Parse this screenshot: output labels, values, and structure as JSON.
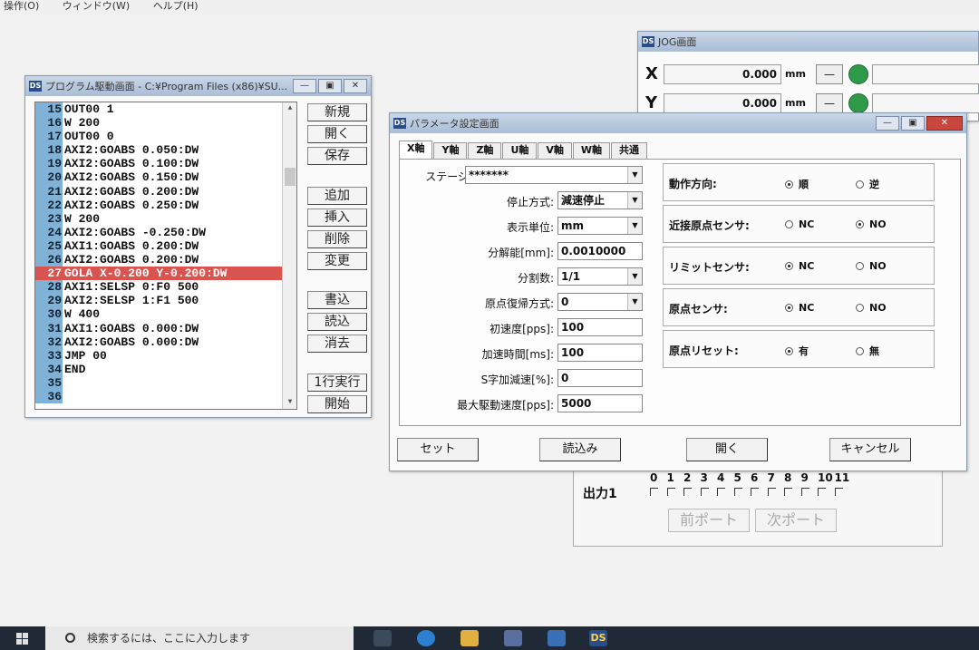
{
  "menubar": [
    "操作(O)",
    "ウィンドウ(W)",
    "ヘルプ(H)"
  ],
  "program_window": {
    "title": "プログラム駆動画面 - C:¥Program Files (x86)¥SU...",
    "lines": [
      {
        "num": "15",
        "code": "OUT00 1"
      },
      {
        "num": "16",
        "code": "W 200"
      },
      {
        "num": "17",
        "code": "OUT00 0"
      },
      {
        "num": "18",
        "code": "AXI2:GOABS 0.050:DW"
      },
      {
        "num": "19",
        "code": "AXI2:GOABS 0.100:DW"
      },
      {
        "num": "20",
        "code": "AXI2:GOABS 0.150:DW"
      },
      {
        "num": "21",
        "code": "AXI2:GOABS 0.200:DW"
      },
      {
        "num": "22",
        "code": "AXI2:GOABS 0.250:DW"
      },
      {
        "num": "23",
        "code": "W 200"
      },
      {
        "num": "24",
        "code": "AXI2:GOABS -0.250:DW"
      },
      {
        "num": "25",
        "code": "AXI1:GOABS 0.200:DW"
      },
      {
        "num": "26",
        "code": "AXI2:GOABS 0.200:DW"
      },
      {
        "num": "27",
        "code": "GOLA X-0.200 Y-0.200:DW"
      },
      {
        "num": "28",
        "code": "AXI1:SELSP 0:F0 500"
      },
      {
        "num": "29",
        "code": "AXI2:SELSP 1:F1 500"
      },
      {
        "num": "30",
        "code": "W 400"
      },
      {
        "num": "31",
        "code": "AXI1:GOABS 0.000:DW"
      },
      {
        "num": "32",
        "code": "AXI2:GOABS 0.000:DW"
      },
      {
        "num": "33",
        "code": "JMP 00"
      },
      {
        "num": "34",
        "code": "END"
      },
      {
        "num": "35",
        "code": ""
      },
      {
        "num": "36",
        "code": ""
      }
    ],
    "selected_line": "27",
    "buttons": {
      "new": "新規",
      "open": "開く",
      "save": "保存",
      "add": "追加",
      "insert": "挿入",
      "delete": "削除",
      "change": "変更",
      "write": "書込",
      "read": "読込",
      "erase": "消去",
      "step": "1行実行",
      "start": "開始"
    }
  },
  "jog_window": {
    "title": "JOG画面",
    "axes": [
      {
        "label": "X",
        "value": "0.000",
        "unit": "mm",
        "btn": "—"
      },
      {
        "label": "Y",
        "value": "0.000",
        "unit": "mm",
        "btn": "—"
      }
    ],
    "led_color": "#2f9a4a"
  },
  "param_window": {
    "title": "パラメータ設定画面",
    "tabs": [
      "X軸",
      "Y軸",
      "Z軸",
      "U軸",
      "V軸",
      "W軸",
      "共通"
    ],
    "active_tab": "X軸",
    "fields": {
      "stage_label": "ステージ:",
      "stage_value": "*******",
      "stop_label": "停止方式:",
      "stop_value": "減速停止",
      "unit_label": "表示単位:",
      "unit_value": "mm",
      "resolution_label": "分解能[mm]:",
      "resolution_value": "0.0010000",
      "division_label": "分割数:",
      "division_value": "1/1",
      "home_label": "原点復帰方式:",
      "home_value": "0",
      "init_speed_label": "初速度[pps]:",
      "init_speed_value": "100",
      "accel_label": "加速時間[ms]:",
      "accel_value": "100",
      "scurve_label": "S字加減速[%]:",
      "scurve_value": "0",
      "max_speed_label": "最大駆動速度[pps]:",
      "max_speed_value": "5000"
    },
    "groups": [
      {
        "label": "動作方向:",
        "options": [
          "順",
          "逆"
        ],
        "selected": 0
      },
      {
        "label": "近接原点センサ:",
        "options": [
          "NC",
          "NO"
        ],
        "selected": 1
      },
      {
        "label": "リミットセンサ:",
        "options": [
          "NC",
          "NO"
        ],
        "selected": 0
      },
      {
        "label": "原点センサ:",
        "options": [
          "NC",
          "NO"
        ],
        "selected": 0
      },
      {
        "label": "原点リセット:",
        "options": [
          "有",
          "無"
        ],
        "selected": 0
      }
    ],
    "buttons": {
      "set": "セット",
      "load": "読込み",
      "open": "開く",
      "cancel": "キャンセル"
    }
  },
  "output_panel": {
    "label": "出力1",
    "bits": [
      "0",
      "1",
      "2",
      "3",
      "4",
      "5",
      "6",
      "7",
      "8",
      "9",
      "10",
      "11"
    ],
    "prev_port": "前ポート",
    "next_port": "次ポート"
  },
  "taskbar": {
    "search_placeholder": "検索するには、ここに入力します",
    "app_label": "DS"
  }
}
